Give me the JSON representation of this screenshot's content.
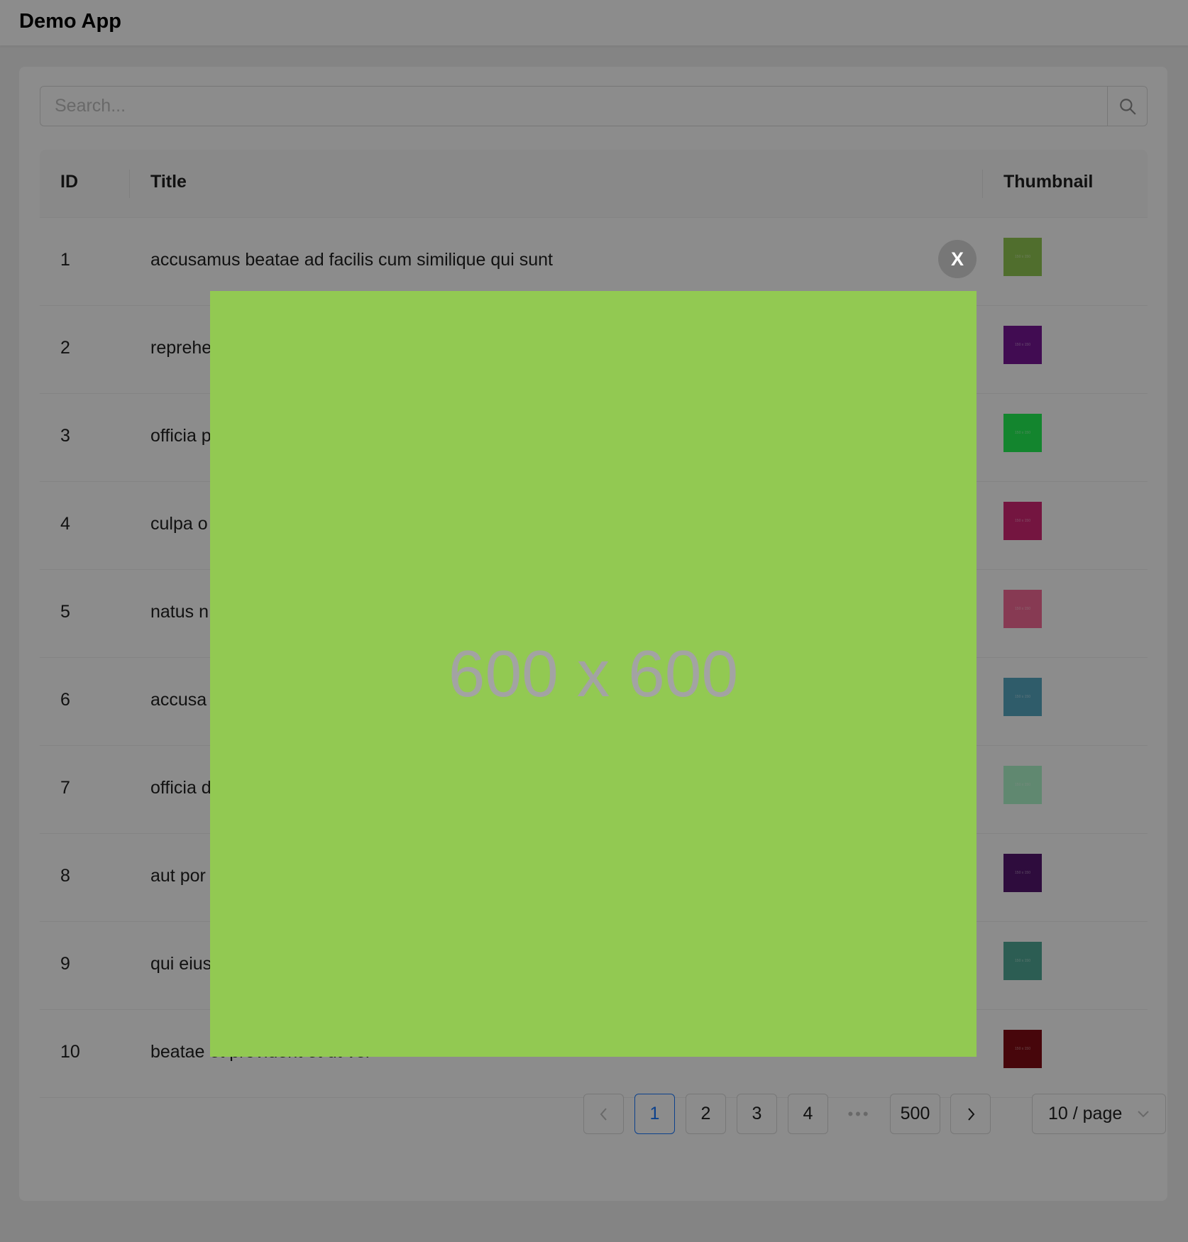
{
  "app": {
    "title": "Demo App"
  },
  "search": {
    "placeholder": "Search...",
    "value": ""
  },
  "table": {
    "columns": {
      "id": "ID",
      "title": "Title",
      "thumbnail": "Thumbnail"
    },
    "rows": [
      {
        "id": "1",
        "title": "accusamus beatae ad facilis cum similique qui sunt",
        "thumb_color": "#92c952",
        "thumb_text": "150 x 150"
      },
      {
        "id": "2",
        "title": "repreheI",
        "thumb_color": "#771796",
        "thumb_text": "150 x 150"
      },
      {
        "id": "3",
        "title": "officia p",
        "thumb_color": "#24f355",
        "thumb_text": "150 x 150"
      },
      {
        "id": "4",
        "title": "culpa o",
        "thumb_color": "#d32776",
        "thumb_text": "150 x 150"
      },
      {
        "id": "5",
        "title": "natus n",
        "thumb_color": "#f66b97",
        "thumb_text": "150 x 150"
      },
      {
        "id": "6",
        "title": "accusa",
        "thumb_color": "#56a8c2",
        "thumb_text": "150 x 150"
      },
      {
        "id": "7",
        "title": "officia d",
        "thumb_color": "#b0f7cc",
        "thumb_text": "150 x 150"
      },
      {
        "id": "8",
        "title": "aut por",
        "thumb_color": "#54176f",
        "thumb_text": "150 x 150"
      },
      {
        "id": "9",
        "title": "qui eius",
        "thumb_color": "#51aa97",
        "thumb_text": "150 x 150"
      },
      {
        "id": "10",
        "title": "beatae et provident et ut vel",
        "thumb_color": "#810b14",
        "thumb_text": "150 x 150"
      }
    ]
  },
  "pagination": {
    "prev": "<",
    "pages": [
      "1",
      "2",
      "3",
      "4"
    ],
    "ellipsis": "•••",
    "last": "500",
    "next": ">",
    "current": "1",
    "page_size": "10 / page"
  },
  "lightbox": {
    "image_text": "600 x 600",
    "image_color": "#92c952",
    "close_label": "X"
  },
  "colors": {
    "accent": "#1677ff",
    "overlay": "rgba(0,0,0,0.45)"
  }
}
